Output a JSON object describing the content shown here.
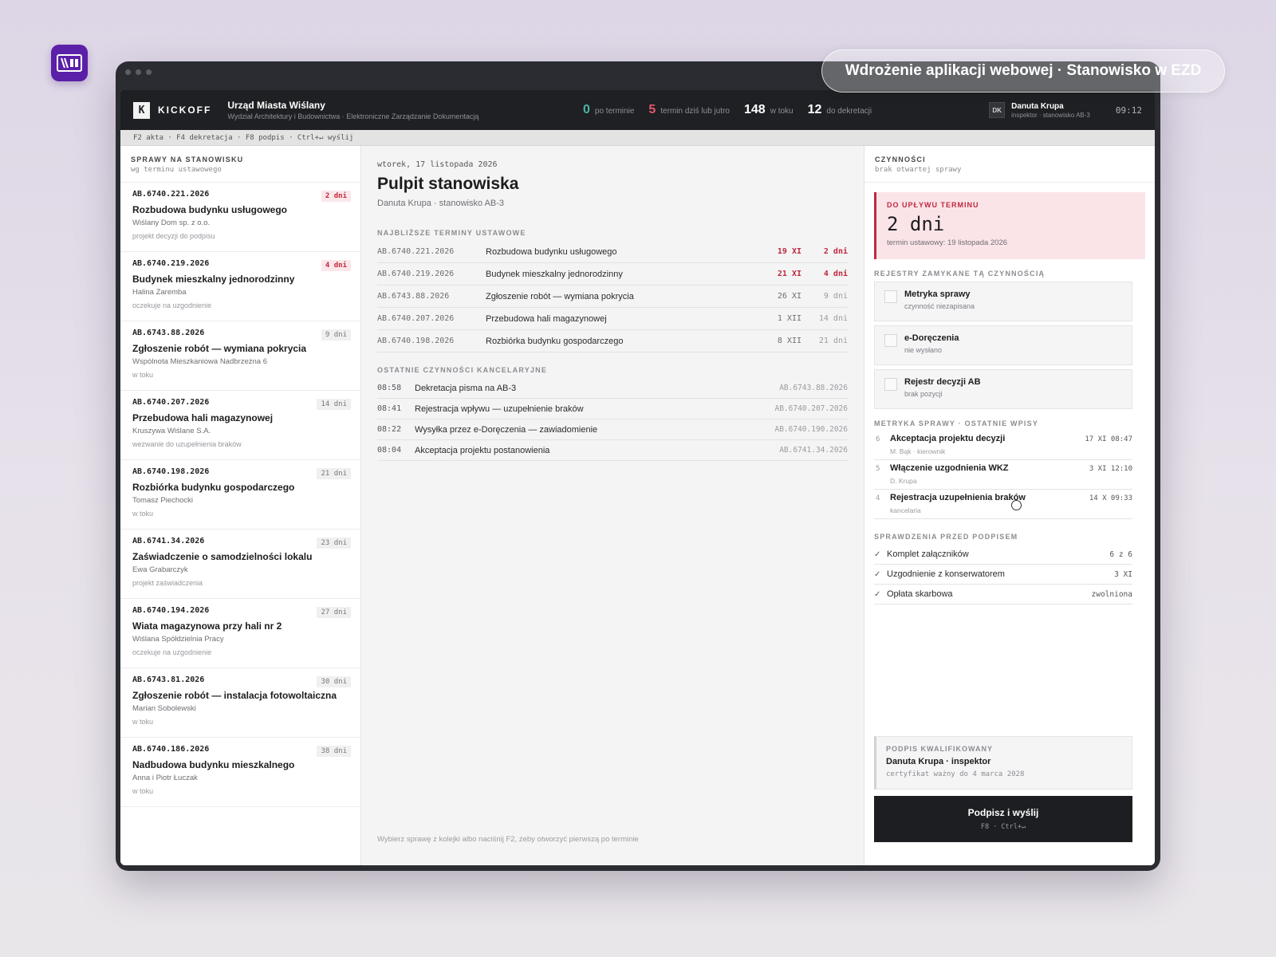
{
  "caption": "Wdrożenie aplikacji webowej · Stanowisko w EZD",
  "colors": {
    "accent_red": "#c0283e",
    "header_bg": "#1f2023",
    "logo_bg": "#5b1fa8"
  },
  "header": {
    "brand_letter": "K",
    "brand_name": "KICKOFF",
    "org_name": "Urząd Miasta Wiślany",
    "org_sub": "Wydział Architektury i Budownictwa · Elektroniczne Zarządzanie Dokumentacją",
    "stats": [
      {
        "value": "0",
        "label": "po terminie",
        "color": "#4fb3a4"
      },
      {
        "value": "5",
        "label": "termin dziś lub jutro",
        "color": "#e2566d"
      },
      {
        "value": "148",
        "label": "w toku",
        "color": "#ffffff"
      },
      {
        "value": "12",
        "label": "do dekretacji",
        "color": "#ffffff"
      }
    ],
    "user_initials": "DK",
    "user_name": "Danuta Krupa",
    "user_role": "inspektor · stanowisko AB-3",
    "time": "09:12"
  },
  "shortcuts": "F2 akta · F4 dekretacja · F8 podpis · Ctrl+↵ wyślij",
  "left": {
    "title": "SPRAWY NA STANOWISKU",
    "subtitle": "wg terminu ustawowego",
    "cases": [
      {
        "sig": "AB.6740.221.2026",
        "title": "Rozbudowa budynku usługowego",
        "party": "Wiślany Dom sp. z o.o.",
        "status": "projekt decyzji do podpisu",
        "days": "2 dni",
        "urgent": true
      },
      {
        "sig": "AB.6740.219.2026",
        "title": "Budynek mieszkalny jednorodzinny",
        "party": "Halina Zaremba",
        "status": "oczekuje na uzgodnienie",
        "days": "4 dni",
        "urgent": true
      },
      {
        "sig": "AB.6743.88.2026",
        "title": "Zgłoszenie robót — wymiana pokrycia",
        "party": "Wspólnota Mieszkaniowa Nadbrzeżna 6",
        "status": "w toku",
        "days": "9 dni",
        "urgent": false
      },
      {
        "sig": "AB.6740.207.2026",
        "title": "Przebudowa hali magazynowej",
        "party": "Kruszywa Wiślane S.A.",
        "status": "wezwanie do uzupełnienia braków",
        "days": "14 dni",
        "urgent": false
      },
      {
        "sig": "AB.6740.198.2026",
        "title": "Rozbiórka budynku gospodarczego",
        "party": "Tomasz Piechocki",
        "status": "w toku",
        "days": "21 dni",
        "urgent": false
      },
      {
        "sig": "AB.6741.34.2026",
        "title": "Zaświadczenie o samodzielności lokalu",
        "party": "Ewa Grabarczyk",
        "status": "projekt zaświadczenia",
        "days": "23 dni",
        "urgent": false
      },
      {
        "sig": "AB.6740.194.2026",
        "title": "Wiata magazynowa przy hali nr 2",
        "party": "Wiślana Spółdzielnia Pracy",
        "status": "oczekuje na uzgodnienie",
        "days": "27 dni",
        "urgent": false
      },
      {
        "sig": "AB.6743.81.2026",
        "title": "Zgłoszenie robót — instalacja fotowoltaiczna",
        "party": "Marian Sobolewski",
        "status": "w toku",
        "days": "30 dni",
        "urgent": false
      },
      {
        "sig": "AB.6740.186.2026",
        "title": "Nadbudowa budynku mieszkalnego",
        "party": "Anna i Piotr Łuczak",
        "status": "w toku",
        "days": "38 dni",
        "urgent": false
      }
    ]
  },
  "center": {
    "date": "wtorek, 17 listopada 2026",
    "title": "Pulpit stanowiska",
    "subtitle": "Danuta Krupa · stanowisko AB-3",
    "deadlines_label": "NAJBLIŻSZE TERMINY USTAWOWE",
    "deadlines": [
      {
        "sig": "AB.6740.221.2026",
        "name": "Rozbudowa budynku usługowego",
        "date": "19 XI",
        "days": "2 dni",
        "urgent": true
      },
      {
        "sig": "AB.6740.219.2026",
        "name": "Budynek mieszkalny jednorodzinny",
        "date": "21 XI",
        "days": "4 dni",
        "urgent": true
      },
      {
        "sig": "AB.6743.88.2026",
        "name": "Zgłoszenie robót — wymiana pokrycia",
        "date": "26 XI",
        "days": "9 dni",
        "urgent": false
      },
      {
        "sig": "AB.6740.207.2026",
        "name": "Przebudowa hali magazynowej",
        "date": "1 XII",
        "days": "14 dni",
        "urgent": false
      },
      {
        "sig": "AB.6740.198.2026",
        "name": "Rozbiórka budynku gospodarczego",
        "date": "8 XII",
        "days": "21 dni",
        "urgent": false
      }
    ],
    "activities_label": "OSTATNIE CZYNNOŚCI KANCELARYJNE",
    "activities": [
      {
        "time": "08:58",
        "name": "Dekretacja pisma na AB-3",
        "sig": "AB.6743.88.2026"
      },
      {
        "time": "08:41",
        "name": "Rejestracja wpływu — uzupełnienie braków",
        "sig": "AB.6740.207.2026"
      },
      {
        "time": "08:22",
        "name": "Wysyłka przez e-Doręczenia — zawiadomienie",
        "sig": "AB.6740.190.2026"
      },
      {
        "time": "08:04",
        "name": "Akceptacja projektu postanowienia",
        "sig": "AB.6741.34.2026"
      }
    ],
    "footer_hint": "Wybierz sprawę z kolejki albo naciśnij F2, żeby otworzyć pierwszą po terminie"
  },
  "right": {
    "title": "CZYNNOŚCI",
    "subtitle": "brak otwartej sprawy",
    "deadline_label": "DO UPŁYWU TERMINU",
    "deadline_value": "2 dni",
    "deadline_note": "termin ustawowy: 19 listopada 2026",
    "registers_label": "REJESTRY ZAMYKANE TĄ CZYNNOŚCIĄ",
    "registers": [
      {
        "name": "Metryka sprawy",
        "status": "czynność niezapisana"
      },
      {
        "name": "e-Doręczenia",
        "status": "nie wysłano"
      },
      {
        "name": "Rejestr decyzji AB",
        "status": "brak pozycji"
      }
    ],
    "log_label": "METRYKA SPRAWY · OSTATNIE WPISY",
    "log": [
      {
        "num": "6",
        "name": "Akceptacja projektu decyzji",
        "who": "M. Bąk · kierownik",
        "when": "17 XI 08:47"
      },
      {
        "num": "5",
        "name": "Włączenie uzgodnienia WKZ",
        "who": "D. Krupa",
        "when": "3 XI 12:10"
      },
      {
        "num": "4",
        "name": "Rejestracja uzupełnienia braków",
        "who": "kancelaria",
        "when": "14 X 09:33"
      }
    ],
    "checks_label": "SPRAWDZENIA PRZED PODPISEM",
    "checks": [
      {
        "mark": "✓",
        "name": "Komplet załączników",
        "value": "6 z 6"
      },
      {
        "mark": "✓",
        "name": "Uzgodnienie z konserwatorem",
        "value": "3 XI"
      },
      {
        "mark": "✓",
        "name": "Opłata skarbowa",
        "value": "zwolniona"
      }
    ],
    "sign_label": "PODPIS KWALIFIKOWANY",
    "sign_name": "Danuta Krupa · inspektor",
    "sign_cert": "certyfikat ważny do 4 marca 2028",
    "sign_button": "Podpisz i wyślij",
    "sign_keys": "F8 · Ctrl+↵"
  }
}
